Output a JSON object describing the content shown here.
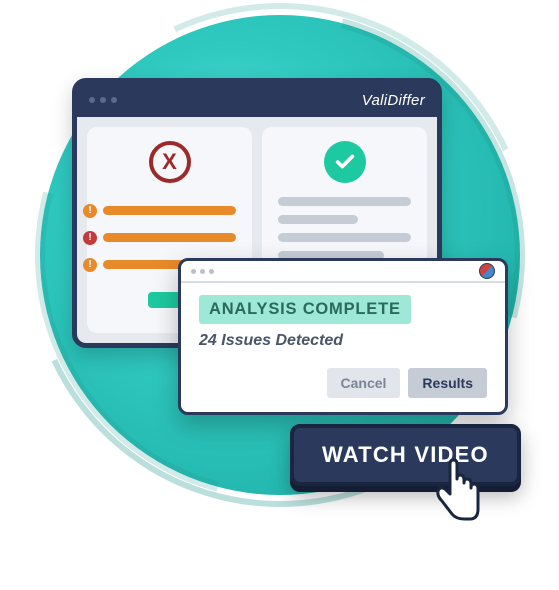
{
  "brand": "ValiDiffer",
  "left_pane": {
    "status_icon": "x-icon",
    "errors": [
      {
        "type": "warning",
        "color": "#e88a2a"
      },
      {
        "type": "error",
        "color": "#c43a3a"
      },
      {
        "type": "warning",
        "color": "#e88a2a"
      }
    ]
  },
  "right_pane": {
    "status_icon": "check-icon"
  },
  "dialog": {
    "title": "ANALYSIS COMPLETE",
    "subtitle": "24 Issues Detected",
    "cancel_label": "Cancel",
    "results_label": "Results"
  },
  "cta": {
    "label": "WATCH VIDEO"
  },
  "colors": {
    "accent_teal": "#1dc9a0",
    "navy": "#2b3a5c",
    "error_red": "#9c2a2a",
    "warning_orange": "#e88a2a"
  }
}
